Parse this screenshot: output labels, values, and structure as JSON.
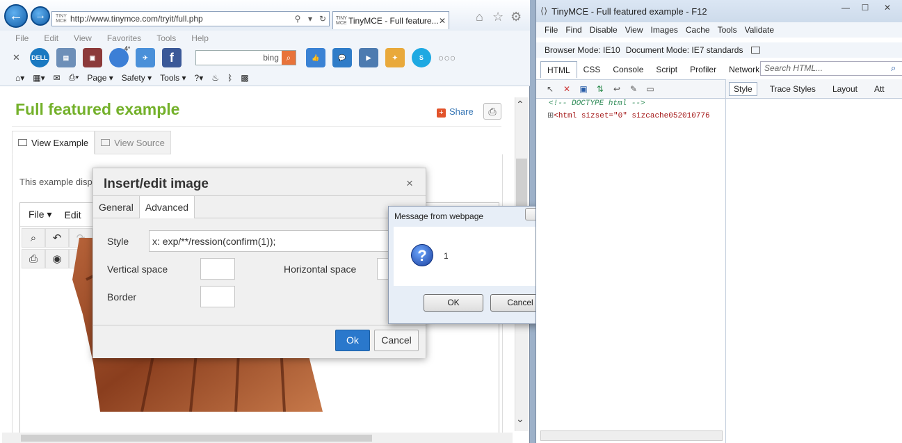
{
  "browser": {
    "address": "http://www.tinymce.com/tryit/full.php",
    "address_favicon": "TINY MCE",
    "tab_title": "TinyMCE - Full feature...",
    "menu": [
      "File",
      "Edit",
      "View",
      "Favorites",
      "Tools",
      "Help"
    ],
    "bing_label": "bing",
    "weather": "4°",
    "command_bar": [
      "Page ▾",
      "Safety ▾",
      "Tools ▾"
    ]
  },
  "page": {
    "title": "Full featured example",
    "share": "Share",
    "tabs": [
      "View Example",
      "View Source"
    ],
    "description": "This example disp",
    "editor_menu": [
      "File ▾",
      "Edit"
    ]
  },
  "dialog": {
    "title": "Insert/edit image",
    "close": "×",
    "tabs": [
      "General",
      "Advanced"
    ],
    "style_label": "Style",
    "style_value": "x: exp/**/ression(confirm(1));",
    "vspace_label": "Vertical space",
    "hspace_label": "Horizontal space",
    "border_label": "Border",
    "ok": "Ok",
    "cancel": "Cancel"
  },
  "message": {
    "title": "Message from webpage",
    "text": "1",
    "ok": "OK",
    "cancel": "Cancel"
  },
  "devtools": {
    "title": "TinyMCE - Full featured example - F12",
    "menu": [
      "File",
      "Find",
      "Disable",
      "View",
      "Images",
      "Cache",
      "Tools",
      "Validate"
    ],
    "browser_mode": "Browser Mode: IE10",
    "document_mode": "Document Mode: IE7 standards",
    "tabs": [
      "HTML",
      "CSS",
      "Console",
      "Script",
      "Profiler",
      "Network"
    ],
    "search_placeholder": "Search HTML...",
    "style_tabs": [
      "Style",
      "Trace Styles",
      "Layout",
      "Att"
    ],
    "code_comment": "<!-- DOCTYPE html -->",
    "code_html": "<html sizset=\"0\" sizcache052010776"
  },
  "colors": {
    "accent": "#74b12b",
    "ok_blue": "#2a78cc"
  }
}
